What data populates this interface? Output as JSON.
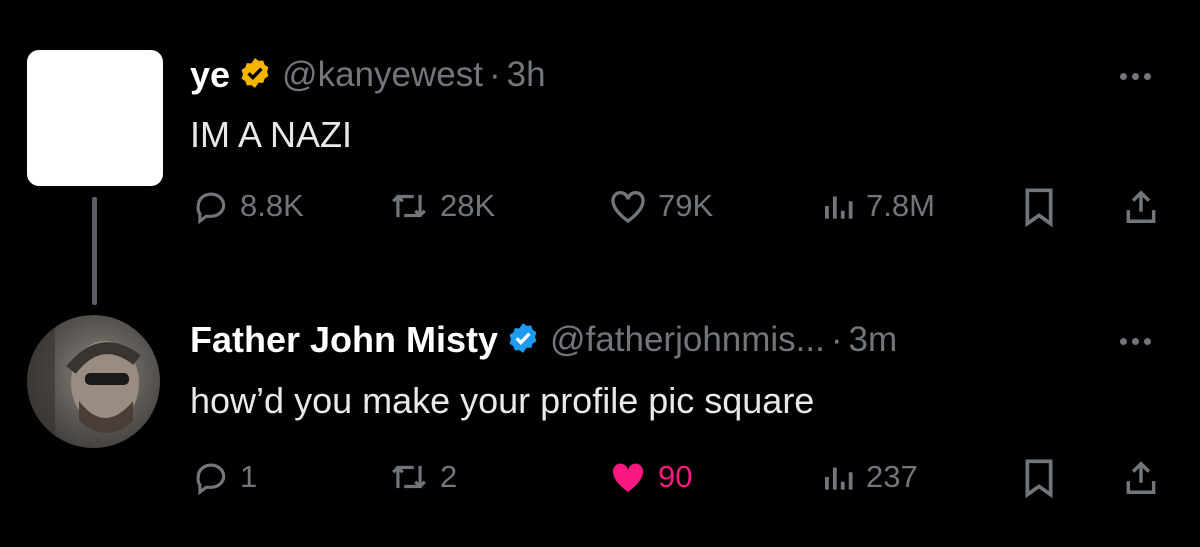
{
  "tweet1": {
    "name": "ye",
    "handle": "@kanyewest",
    "separator": "·",
    "time": "3h",
    "text": "IM A NAZI",
    "verified_color": "#f4b400",
    "actions": {
      "replies": "8.8K",
      "reposts": "28K",
      "likes": "79K",
      "views": "7.8M"
    }
  },
  "tweet2": {
    "name": "Father John Misty",
    "handle": "@fatherjohnmis...",
    "separator": "·",
    "time": "3m",
    "text": "how’d you make your profile pic square",
    "verified_color": "#1d9bf0",
    "actions": {
      "replies": "1",
      "reposts": "2",
      "likes": "90",
      "views": "237"
    },
    "liked": true
  },
  "colors": {
    "background": "#000000",
    "muted": "#71767b",
    "like_pink": "#f91880"
  }
}
